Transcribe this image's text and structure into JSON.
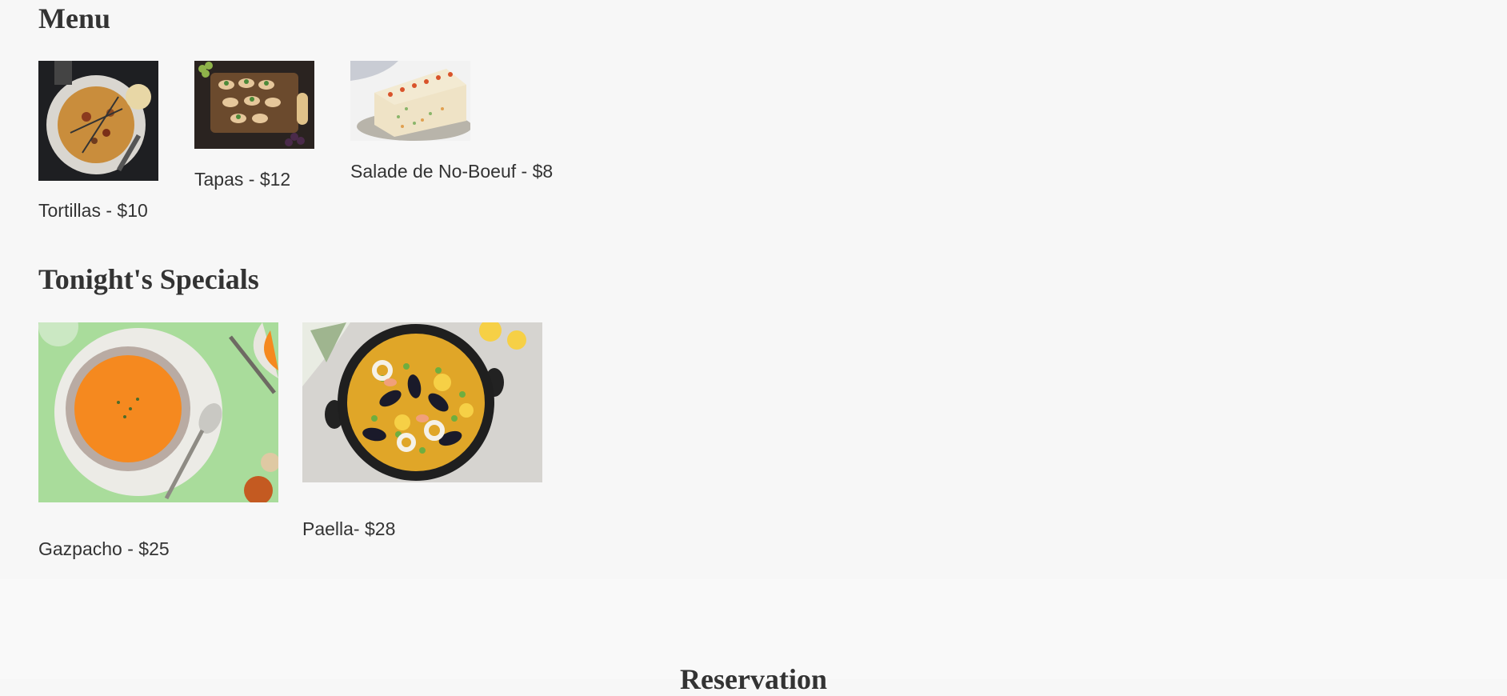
{
  "menu": {
    "title": "Menu",
    "items": [
      {
        "label": "Tortillas - $10",
        "image": "tortilla-photo"
      },
      {
        "label": "Tapas - $12",
        "image": "tapas-photo"
      },
      {
        "label": "Salade de No-Boeuf - $8",
        "image": "salad-terrine-photo"
      }
    ]
  },
  "specials": {
    "title": "Tonight's Specials",
    "items": [
      {
        "label": "Gazpacho - $25",
        "image": "gazpacho-photo"
      },
      {
        "label": "Paella- $28",
        "image": "paella-photo"
      }
    ]
  },
  "reservation": {
    "title": "Reservation"
  },
  "colors": {
    "background": "#f7f7f7",
    "text": "#333333"
  }
}
